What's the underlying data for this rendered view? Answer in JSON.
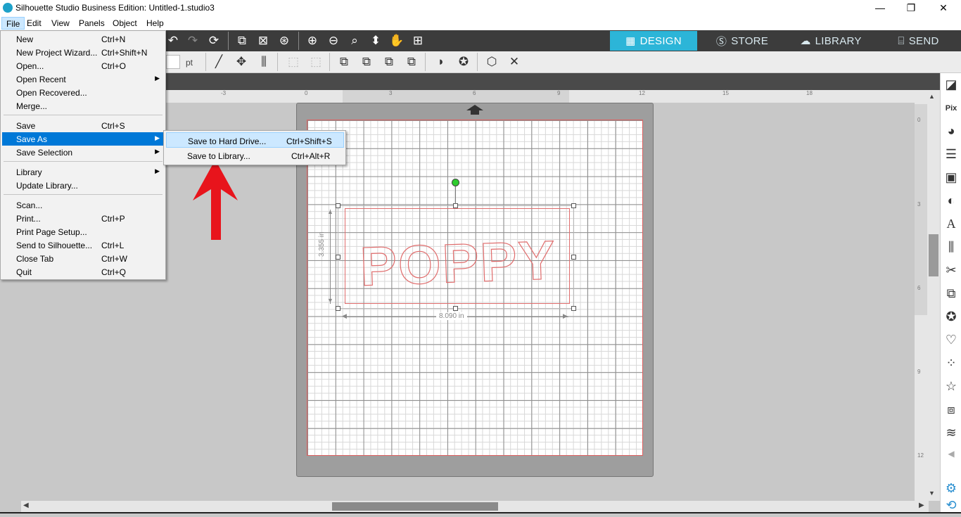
{
  "window": {
    "title": "Silhouette Studio Business Edition: Untitled-1.studio3",
    "minimize": "—",
    "maximize": "❐",
    "close": "✕"
  },
  "menubar": [
    "File",
    "Edit",
    "View",
    "Panels",
    "Object",
    "Help"
  ],
  "nav_tabs": [
    {
      "label": "DESIGN",
      "icon": "grid-icon"
    },
    {
      "label": "STORE",
      "icon": "silhouette-s-icon"
    },
    {
      "label": "LIBRARY",
      "icon": "cloud-icon"
    },
    {
      "label": "SEND",
      "icon": "cutter-icon"
    }
  ],
  "toolbar2": {
    "unit": "pt"
  },
  "file_menu": {
    "items": [
      {
        "label": "New",
        "shortcut": "Ctrl+N"
      },
      {
        "label": "New Project Wizard...",
        "shortcut": "Ctrl+Shift+N"
      },
      {
        "label": "Open...",
        "shortcut": "Ctrl+O"
      },
      {
        "label": "Open Recent",
        "shortcut": "",
        "submenu": true
      },
      {
        "label": "Open Recovered...",
        "shortcut": ""
      },
      {
        "label": "Merge...",
        "shortcut": ""
      },
      {
        "label": "Save",
        "shortcut": "Ctrl+S"
      },
      {
        "label": "Save As",
        "shortcut": "",
        "submenu": true,
        "highlighted": true
      },
      {
        "label": "Save Selection",
        "shortcut": "",
        "submenu": true
      },
      {
        "label": "Library",
        "shortcut": "",
        "submenu": true
      },
      {
        "label": "Update Library...",
        "shortcut": ""
      },
      {
        "label": "Scan...",
        "shortcut": ""
      },
      {
        "label": "Print...",
        "shortcut": "Ctrl+P"
      },
      {
        "label": "Print Page Setup...",
        "shortcut": ""
      },
      {
        "label": "Send to Silhouette...",
        "shortcut": "Ctrl+L"
      },
      {
        "label": "Close Tab",
        "shortcut": "Ctrl+W"
      },
      {
        "label": "Quit",
        "shortcut": "Ctrl+Q"
      }
    ]
  },
  "save_as_submenu": [
    {
      "label": "Save to Hard Drive...",
      "shortcut": "Ctrl+Shift+S"
    },
    {
      "label": "Save to Library...",
      "shortcut": "Ctrl+Alt+R"
    }
  ],
  "ruler_top": [
    "-3",
    "0",
    "3",
    "6",
    "9",
    "12",
    "15",
    "18"
  ],
  "ruler_right": [
    "0",
    "3",
    "6",
    "9",
    "12"
  ],
  "design": {
    "text": "POPPY",
    "height_label": "3.355 in",
    "width_label": "8.090 in"
  },
  "colors": {
    "accent": "#2cb5d8",
    "menu_highlight": "#0078d7",
    "cut_line": "#e06d6d",
    "arrow": "#e8141c"
  }
}
